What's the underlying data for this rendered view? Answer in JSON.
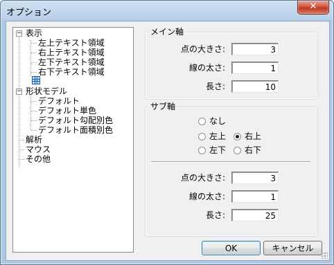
{
  "window": {
    "title": "オプション",
    "close_glyph": "✕"
  },
  "tree": {
    "expand_minus": "−",
    "nodes": {
      "display": "表示",
      "top_left": "左上テキスト領域",
      "top_right": "右上テキスト領域",
      "bottom_left": "左下テキスト領域",
      "bottom_right": "右下テキスト領域",
      "shape_model": "形状モデル",
      "default": "デフォルト",
      "default_single": "デフォルト単色",
      "default_gradient": "デフォルト勾配別色",
      "default_area": "デフォルト面積別色",
      "analysis": "解析",
      "mouse": "マウス",
      "other": "その他"
    }
  },
  "main_axis": {
    "legend": "メイン軸",
    "point_size_label": "点の大きさ:",
    "point_size_value": "3",
    "line_width_label": "線の太さ:",
    "line_width_value": "1",
    "length_label": "長さ:",
    "length_value": "10"
  },
  "sub_axis": {
    "legend": "サブ軸",
    "none": "なし",
    "top_left": "左上",
    "top_right": "右上",
    "bottom_left": "左下",
    "bottom_right": "右下",
    "selected": "右上",
    "point_size_label": "点の大きさ:",
    "point_size_value": "3",
    "line_width_label": "線の太さ:",
    "line_width_value": "1",
    "length_label": "長さ:",
    "length_value": "25"
  },
  "buttons": {
    "ok": "OK",
    "cancel": "キャンセル"
  }
}
